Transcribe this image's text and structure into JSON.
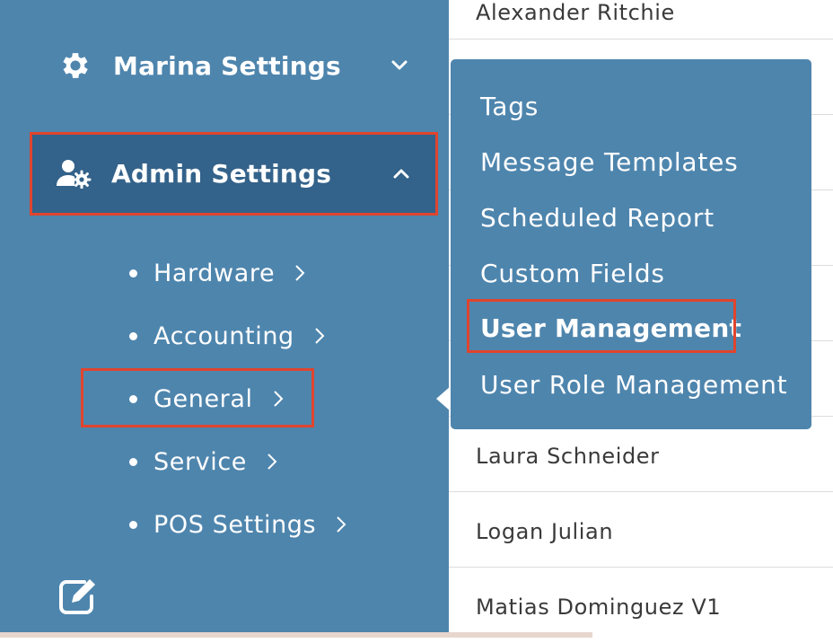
{
  "sidebar": {
    "marina_settings": {
      "label": "Marina Settings",
      "icon": "gear-icon",
      "chevron": "chevron-down-icon"
    },
    "admin_settings": {
      "label": "Admin Settings",
      "icon": "user-gear-icon",
      "chevron": "chevron-up-icon"
    },
    "sub_items": [
      {
        "label": "Hardware"
      },
      {
        "label": "Accounting"
      },
      {
        "label": "General"
      },
      {
        "label": "Service"
      },
      {
        "label": "POS Settings"
      }
    ],
    "edit_icon": "edit-icon"
  },
  "flyout": {
    "items": [
      {
        "label": "Tags"
      },
      {
        "label": "Message Templates"
      },
      {
        "label": "Scheduled Report"
      },
      {
        "label": "Custom Fields"
      },
      {
        "label": "User Management"
      },
      {
        "label": "User Role Management"
      }
    ]
  },
  "list": {
    "rows": [
      {
        "name": "Alexander Ritchie"
      },
      {
        "name": "Laura Schneider"
      },
      {
        "name": "Logan Julian"
      },
      {
        "name": "Matias Dominguez V1"
      }
    ]
  },
  "colors": {
    "sidebar_bg": "#4e85ad",
    "active_bg": "#33628a",
    "highlight": "#e0442e"
  }
}
